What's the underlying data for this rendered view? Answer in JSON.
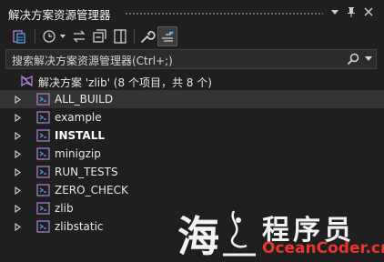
{
  "window": {
    "title": "解决方案资源管理器"
  },
  "search": {
    "placeholder": "搜索解决方案资源管理器(Ctrl+;)"
  },
  "solution": {
    "label": "解决方案 'zlib' (8 个项目，共 8 个)"
  },
  "projects": [
    {
      "name": "ALL_BUILD",
      "bold": false,
      "selected": true
    },
    {
      "name": "example",
      "bold": false,
      "selected": false
    },
    {
      "name": "INSTALL",
      "bold": true,
      "selected": false
    },
    {
      "name": "minigzip",
      "bold": false,
      "selected": false
    },
    {
      "name": "RUN_TESTS",
      "bold": false,
      "selected": false
    },
    {
      "name": "ZERO_CHECK",
      "bold": false,
      "selected": false
    },
    {
      "name": "zlib",
      "bold": false,
      "selected": false
    },
    {
      "name": "zlibstatic",
      "bold": false,
      "selected": false
    }
  ],
  "watermark": {
    "cn": "程序员",
    "en": "OceanCoder.cn",
    "logo_text": "海"
  },
  "colors": {
    "background": "#1f1f1f",
    "selected_row": "#333333",
    "project_icon": "#b180d7",
    "accent_blue": "#4fa3e8",
    "watermark_red": "#e8372c"
  },
  "icons": {
    "toolbar": [
      "switch-views-icon",
      "history-icon",
      "sync-icon",
      "collapse-all-icon",
      "show-all-files-icon",
      "properties-icon",
      "preview-icon"
    ]
  }
}
